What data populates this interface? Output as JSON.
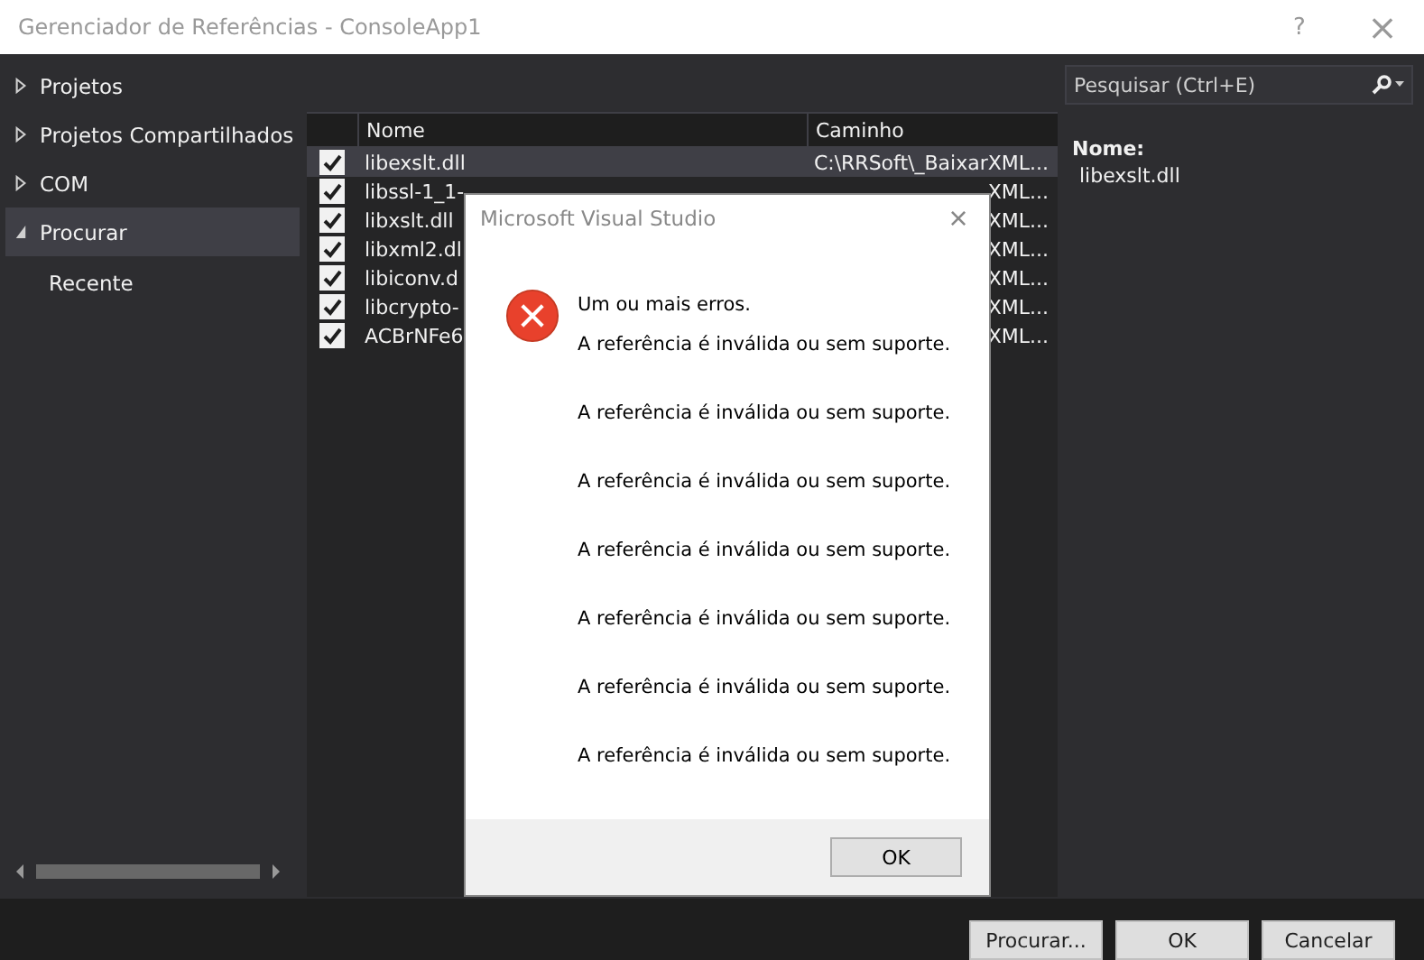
{
  "window": {
    "title": "Gerenciador de Referências - ConsoleApp1",
    "help": "?",
    "close": "×"
  },
  "sidebar": {
    "items": [
      {
        "label": "Projetos",
        "expanded": false,
        "selected": false
      },
      {
        "label": "Projetos Compartilhados",
        "expanded": false,
        "selected": false
      },
      {
        "label": "COM",
        "expanded": false,
        "selected": false
      },
      {
        "label": "Procurar",
        "expanded": true,
        "selected": true,
        "children": [
          {
            "label": "Recente",
            "selected": false
          }
        ]
      }
    ]
  },
  "table": {
    "columns": [
      "Nome",
      "Caminho"
    ],
    "rows": [
      {
        "name": "libexslt.dll",
        "path": "C:\\RRSoft\\_BaixarXML...",
        "checked": true,
        "selected": true
      },
      {
        "name": "libssl-1_1-",
        "path": "XML...",
        "checked": true,
        "selected": false
      },
      {
        "name": "libxslt.dll",
        "path": "XML...",
        "checked": true,
        "selected": false
      },
      {
        "name": "libxml2.dl",
        "path": "XML...",
        "checked": true,
        "selected": false
      },
      {
        "name": "libiconv.d",
        "path": "XML...",
        "checked": true,
        "selected": false
      },
      {
        "name": "libcrypto-",
        "path": "XML...",
        "checked": true,
        "selected": false
      },
      {
        "name": "ACBrNFe6",
        "path": "XML...",
        "checked": true,
        "selected": false
      }
    ]
  },
  "search": {
    "placeholder": "Pesquisar (Ctrl+E)"
  },
  "details": {
    "label": "Nome:",
    "value": "libexslt.dll"
  },
  "buttons": [
    "Procurar...",
    "OK",
    "Cancelar"
  ],
  "dialog": {
    "title": "Microsoft Visual Studio",
    "close": "×",
    "heading": "Um ou mais erros.",
    "messages": [
      "A referência é inválida ou sem suporte.",
      "A referência é inválida ou sem suporte.",
      "A referência é inválida ou sem suporte.",
      "A referência é inválida ou sem suporte.",
      "A referência é inválida ou sem suporte.",
      "A referência é inválida ou sem suporte.",
      "A referência é inválida ou sem suporte."
    ],
    "button": "OK"
  }
}
